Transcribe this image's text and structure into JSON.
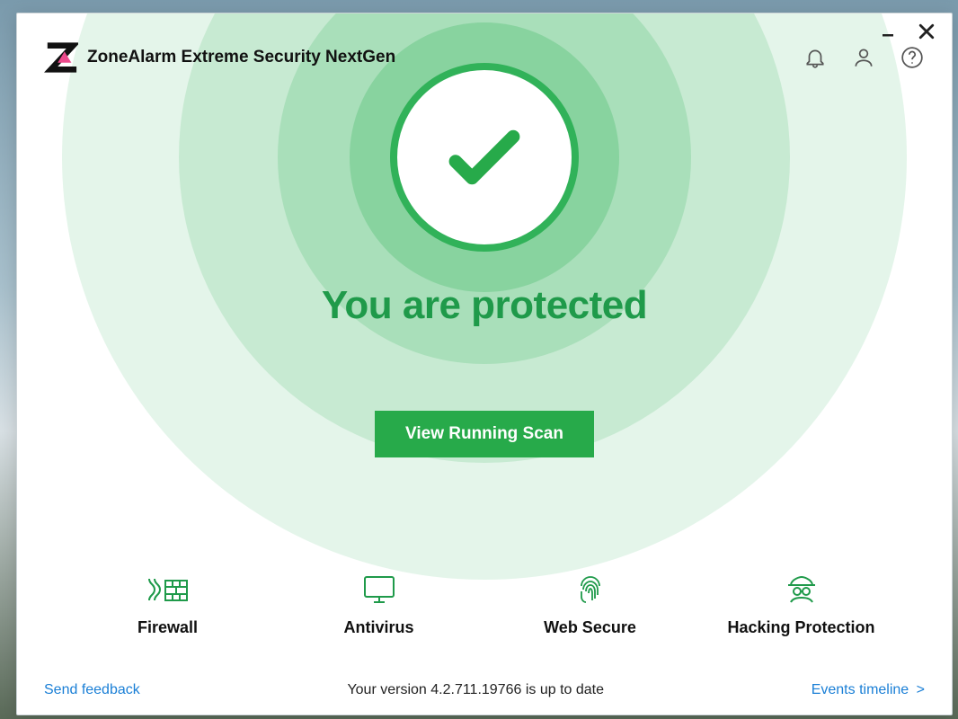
{
  "header": {
    "app_title": "ZoneAlarm Extreme Security NextGen"
  },
  "status": {
    "heading": "You are protected",
    "scan_button_label": "View Running Scan"
  },
  "modules": [
    {
      "label": "Firewall"
    },
    {
      "label": "Antivirus"
    },
    {
      "label": "Web Secure"
    },
    {
      "label": "Hacking Protection"
    }
  ],
  "footer": {
    "feedback_link": "Send feedback",
    "version_text": "Your version 4.2.711.19766 is up to date",
    "events_link": "Events timeline"
  }
}
